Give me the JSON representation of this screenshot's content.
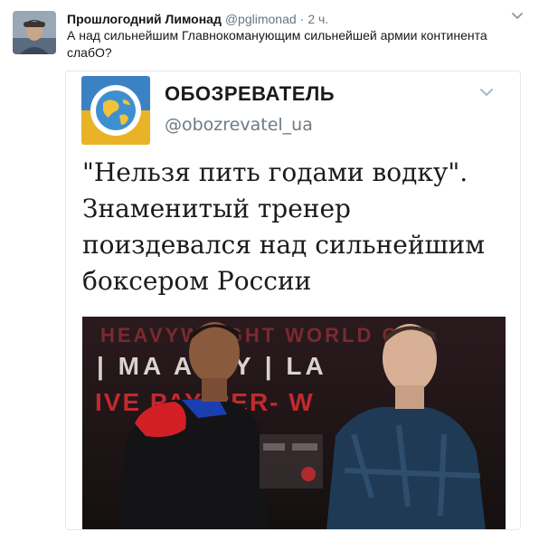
{
  "tweet": {
    "author_name": "Прошлогодний Лимонад",
    "author_handle": "@pglimonad",
    "separator": "·",
    "timestamp": "2 ч.",
    "text": "А над сильнейшим Главнокоманующим сильнейшей армии континента\nслабО?"
  },
  "quoted": {
    "name": "ОБОЗРЕВАТЕЛЬ",
    "handle": "@obozrevatel_ua",
    "headline": "\"Нельзя пить годами водку\".\nЗнаменитый тренер\nпоиздевался над сильнейшим\nбоксером России",
    "photo_banner": {
      "line1": "HEAVYWEIGHT WORLD CH",
      "line2": "| MA  ALAY | LA",
      "line3": "IVE    PAY-PER-  W"
    }
  },
  "icons": {
    "caret": "chevron-down-icon",
    "logo": "globe-logo"
  },
  "colors": {
    "text": "#14171a",
    "muted": "#657786",
    "border": "#e1e8ed"
  }
}
